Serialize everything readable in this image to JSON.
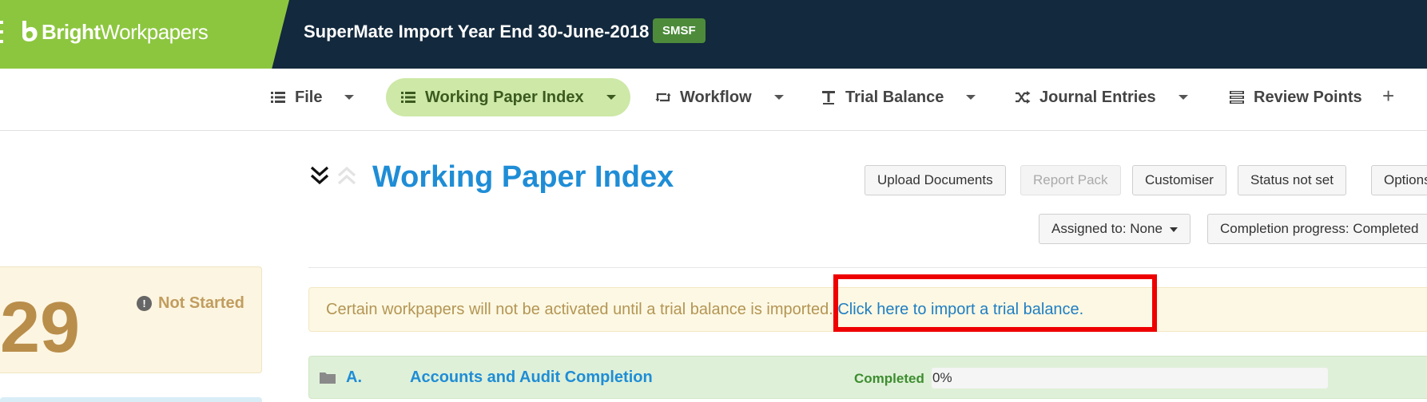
{
  "header": {
    "brand_bold": "Bright",
    "brand_light": "Workpapers",
    "title": "SuperMate Import Year End 30-June-2018",
    "badge": "SMSF"
  },
  "nav": {
    "items": [
      {
        "label": "File",
        "icon": "list-icon"
      },
      {
        "label": "Working Paper Index",
        "icon": "list-icon",
        "active": true
      },
      {
        "label": "Workflow",
        "icon": "retweet-icon"
      },
      {
        "label": "Trial Balance",
        "icon": "text-height-icon"
      },
      {
        "label": "Journal Entries",
        "icon": "random-icon"
      },
      {
        "label": "Review Points",
        "icon": "tasks-icon"
      }
    ],
    "more": "+"
  },
  "sidebar": {
    "number": "29",
    "status_label": "Not Started",
    "status_icon": "exclamation-circle-icon"
  },
  "main": {
    "title": "Working Paper Index",
    "buttons": {
      "upload": "Upload Documents",
      "report_pack": "Report Pack",
      "customiser": "Customiser",
      "status": "Status not set",
      "options": "Options",
      "assigned": "Assigned to: None",
      "completion": "Completion progress: Completed"
    },
    "alert": {
      "text": "Certain workpapers will not be activated until a trial balance is imported.",
      "link": "Click here to import a trial balance."
    },
    "sections": [
      {
        "code": "A.",
        "name": "Accounts and Audit Completion",
        "status": "Completed",
        "progress_label": "0%",
        "progress": 0
      }
    ]
  },
  "colors": {
    "brand_green": "#8cc63f",
    "header_navy": "#13293d",
    "title_blue": "#1f8dd6",
    "highlight_red": "#ee0000"
  }
}
